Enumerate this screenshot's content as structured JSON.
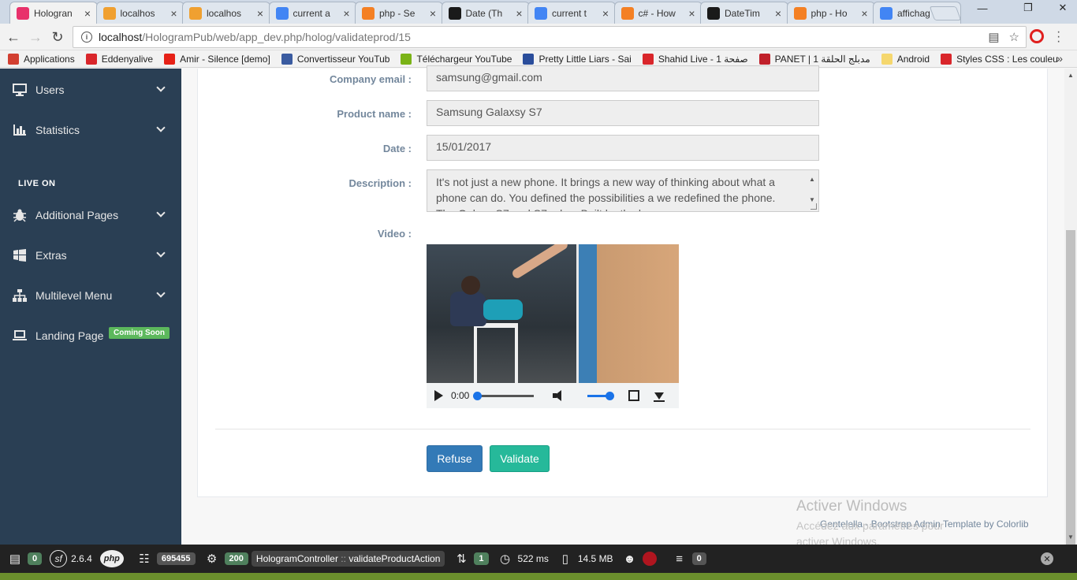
{
  "browser": {
    "tabs": [
      {
        "title": "Hologran",
        "icon": "hologram-icon",
        "color": "#e8316b",
        "active": true
      },
      {
        "title": "localhos",
        "icon": "phpmyadmin-icon",
        "color": "#f0a030"
      },
      {
        "title": "localhos",
        "icon": "phpmyadmin-icon",
        "color": "#f0a030"
      },
      {
        "title": "current a",
        "icon": "google-icon",
        "color": "#4285f4"
      },
      {
        "title": "php - Se",
        "icon": "stackoverflow-icon",
        "color": "#f48024"
      },
      {
        "title": "Date (Th",
        "icon": "symfony-icon",
        "color": "#1a1a1a"
      },
      {
        "title": "current t",
        "icon": "google-icon",
        "color": "#4285f4"
      },
      {
        "title": "c# - How",
        "icon": "stackoverflow-icon",
        "color": "#f48024"
      },
      {
        "title": "DateTim",
        "icon": "symfony-icon",
        "color": "#1a1a1a"
      },
      {
        "title": "php - Ho",
        "icon": "stackoverflow-icon",
        "color": "#f48024"
      },
      {
        "title": "affichag",
        "icon": "google-icon",
        "color": "#4285f4"
      }
    ],
    "url_host": "localhost",
    "url_path": "/HologramPub/web/app_dev.php/holog/validateprod/15"
  },
  "bookmarks": [
    {
      "label": "Applications",
      "icon": "apps-grid-icon",
      "color": "#d23f31"
    },
    {
      "label": "Eddenyalive",
      "icon": "eddenyalive-icon",
      "color": "#d9262b"
    },
    {
      "label": "Amir - Silence [demo]",
      "icon": "youtube-icon",
      "color": "#e62117"
    },
    {
      "label": "Convertisseur YouTub",
      "icon": "mp3-icon",
      "color": "#3a5ba0"
    },
    {
      "label": "Téléchargeur YouTube",
      "icon": "download-arrow-icon",
      "color": "#7ab317"
    },
    {
      "label": "Pretty Little Liars - Sai",
      "icon": "play-circle-icon",
      "color": "#2a4d9b"
    },
    {
      "label": "Shahid Live - 1 صفحة",
      "icon": "shahid-icon",
      "color": "#d9262b"
    },
    {
      "label": "PANET | 1 مدبلج الحلقة",
      "icon": "panet-icon",
      "color": "#c0202a"
    },
    {
      "label": "Android",
      "icon": "folder-icon",
      "color": "#f5d76e"
    },
    {
      "label": "Styles CSS : Les couleu",
      "icon": "free-icon",
      "color": "#d9262b"
    }
  ],
  "sidebar": {
    "items_top": [
      {
        "label": "Users",
        "icon": "desktop-icon"
      },
      {
        "label": "Statistics",
        "icon": "bar-chart-icon"
      }
    ],
    "section_title": "LIVE ON",
    "items_live": [
      {
        "label": "Additional Pages",
        "icon": "bug-icon"
      },
      {
        "label": "Extras",
        "icon": "windows-icon"
      },
      {
        "label": "Multilevel Menu",
        "icon": "sitemap-icon"
      },
      {
        "label": "Landing Page",
        "icon": "laptop-icon",
        "badge": "Coming Soon"
      }
    ]
  },
  "form": {
    "company_email_label": "Company email :",
    "company_email_value": "samsung@gmail.com",
    "product_name_label": "Product name :",
    "product_name_value": "Samsung Galaxsy S7",
    "date_label": "Date :",
    "date_value": "15/01/2017",
    "description_label": "Description :",
    "description_value": "It's not just a new phone. It brings a new way of thinking about what a phone can do. You defined the possibilities a we redefined the phone. The Galaxy S7 and S7 edge. Built by the legacy we..."
  },
  "video": {
    "label": "Video :",
    "current_time": "0:00",
    "progress": 0.0,
    "volume": 1.0
  },
  "actions": {
    "refuse_label": "Refuse",
    "validate_label": "Validate"
  },
  "footer": {
    "text": "Gentelella - Bootstrap Admin Template by Colorlib"
  },
  "watermark": {
    "title": "Activer Windows",
    "line1": "Accédez aux paramètres pour",
    "line2": "activer Windows."
  },
  "debug_toolbar": {
    "token_count": "0",
    "symfony_version": "2.6.4",
    "php_label": "php",
    "request_token": "695455",
    "status_code": "200",
    "controller": "HologramController",
    "action": "validateProductAction",
    "events_count": "1",
    "time": "522 ms",
    "memory": "14.5 MB",
    "db_queries": "0"
  },
  "colors": {
    "sidebar_bg": "#2a3f54",
    "refuse_btn": "#337ab7",
    "validate_btn": "#26b99a",
    "sf_badge_green": "#4f805d"
  }
}
